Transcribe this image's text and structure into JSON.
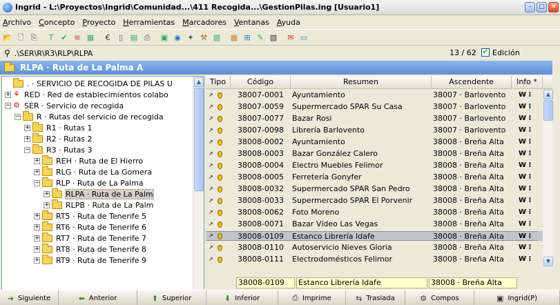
{
  "window": {
    "title": "Ingrid - L:\\Proyectos\\Ingrid\\Comunidad...\\411 Recogida...\\GestionPilas.ing  [Usuario1]"
  },
  "menu": [
    "Archivo",
    "Concepto",
    "Proyecto",
    "Herramientas",
    "Marcadores",
    "Ventanas",
    "Ayuda"
  ],
  "toolbar_icons": [
    "open-folder-icon",
    "new-document-icon",
    "copy-icon",
    "text-icon",
    "validate-icon",
    "rainbow-icon",
    "calculator-icon",
    "euro-icon",
    "page-icon",
    "table-icon",
    "print-icon",
    "save-icon",
    "globe-icon",
    "wizard-icon",
    "tools-icon",
    "database-icon",
    "chart-icon",
    "network-icon",
    "edit-document-icon",
    "folder-save-icon",
    "mail-icon",
    "window-icon"
  ],
  "path": {
    "text": ".\\SER\\R\\R3\\RLP\\RLPA",
    "position": "13 / 62",
    "edit_label": "Edición",
    "edit_checked": true
  },
  "header": {
    "title": "RLPA · Ruta de La Palma A"
  },
  "tree": [
    {
      "label": ". · SERVICIO DE RECOGIDA DE PILAS U",
      "level": 0,
      "expander": "",
      "icon": "folder"
    },
    {
      "label": "RED · Red de establecimientos colabo",
      "level": 0,
      "expander": "+",
      "icon": "network"
    },
    {
      "label": "SER · Servicio de recogida",
      "level": 0,
      "expander": "−",
      "icon": "service"
    },
    {
      "label": "R · Rutas del servicio de recogida",
      "level": 1,
      "expander": "−",
      "icon": "folder"
    },
    {
      "label": "R1 · Rutas 1",
      "level": 2,
      "expander": "+",
      "icon": "folder"
    },
    {
      "label": "R2 · Rutas 2",
      "level": 2,
      "expander": "+",
      "icon": "folder"
    },
    {
      "label": "R3 · Rutas 3",
      "level": 2,
      "expander": "−",
      "icon": "folder"
    },
    {
      "label": "REH · Ruta de El Hierro",
      "level": 3,
      "expander": "+",
      "icon": "folder"
    },
    {
      "label": "RLG · Ruta de La Gomera",
      "level": 3,
      "expander": "+",
      "icon": "folder"
    },
    {
      "label": "RLP · Ruta de La Palma",
      "level": 3,
      "expander": "−",
      "icon": "folder"
    },
    {
      "label": "RLPA · Ruta de La Palm",
      "level": 4,
      "expander": "+",
      "icon": "folder",
      "selected": true
    },
    {
      "label": "RLPB · Ruta de La Palm",
      "level": 4,
      "expander": "+",
      "icon": "folder"
    },
    {
      "label": "RT5 · Ruta de Tenerife 5",
      "level": 3,
      "expander": "+",
      "icon": "folder"
    },
    {
      "label": "RT6 · Ruta de Tenerife 6",
      "level": 3,
      "expander": "+",
      "icon": "folder"
    },
    {
      "label": "RT7 · Ruta de Tenerife 7",
      "level": 3,
      "expander": "+",
      "icon": "folder"
    },
    {
      "label": "RT8 · Ruta de Tenerife 8",
      "level": 3,
      "expander": "+",
      "icon": "folder"
    },
    {
      "label": "RT9 · Ruta de Tenerife 9",
      "level": 3,
      "expander": "+",
      "icon": "folder"
    }
  ],
  "grid": {
    "columns": [
      "Tipo",
      "Código",
      "Resumen",
      "Ascendente",
      "Info *"
    ],
    "rows": [
      {
        "codigo": "38007-0001",
        "resumen": "Ayuntamiento",
        "ascendente": "38007 · Barlovento"
      },
      {
        "codigo": "38007-0059",
        "resumen": "Supermercado SPAR Su Casa",
        "ascendente": "38007 · Barlovento"
      },
      {
        "codigo": "38007-0077",
        "resumen": "Bazar Rosi",
        "ascendente": "38007 · Barlovento"
      },
      {
        "codigo": "38007-0098",
        "resumen": "Librería Barlovento",
        "ascendente": "38007 · Barlovento"
      },
      {
        "codigo": "38008-0002",
        "resumen": "Ayuntamiento",
        "ascendente": "38008 · Breña Alta"
      },
      {
        "codigo": "38008-0003",
        "resumen": "Bazar González Calero",
        "ascendente": "38008 · Breña Alta"
      },
      {
        "codigo": "38008-0004",
        "resumen": "Electro Muebles Felimor",
        "ascendente": "38008 · Breña Alta"
      },
      {
        "codigo": "38008-0005",
        "resumen": "Ferretería Gonyfer",
        "ascendente": "38008 · Breña Alta"
      },
      {
        "codigo": "38008-0032",
        "resumen": "Supermercado SPAR San Pedro",
        "ascendente": "38008 · Breña Alta"
      },
      {
        "codigo": "38008-0033",
        "resumen": "Supermercado SPAR El Porvenir",
        "ascendente": "38008 · Breña Alta"
      },
      {
        "codigo": "38008-0062",
        "resumen": "Foto Moreno",
        "ascendente": "38008 · Breña Alta"
      },
      {
        "codigo": "38008-0071",
        "resumen": "Bazar Vídeo Las Vegas",
        "ascendente": "38008 · Breña Alta"
      },
      {
        "codigo": "38008-0109",
        "resumen": "Estanco Librería Idafe",
        "ascendente": "38008 · Breña Alta",
        "selected": true
      },
      {
        "codigo": "38008-0110",
        "resumen": "Autoservicio Nieves Gloria",
        "ascendente": "38008 · Breña Alta"
      },
      {
        "codigo": "38008-0111",
        "resumen": "Electrodomésticos Felimor",
        "ascendente": "38008 · Breña Alta"
      }
    ],
    "info_glyph": "W ⁝"
  },
  "edit_row": {
    "codigo": "38008-0109",
    "resumen": "Estanco Librería Idafe",
    "ascendente": "38008 · Breña Alta"
  },
  "bottom_buttons": [
    {
      "label": "Siguiente",
      "icon": "arrow-right-icon",
      "glyph": "➜"
    },
    {
      "label": "Anterior",
      "icon": "arrow-left-icon",
      "glyph": "⬅"
    },
    {
      "label": "Superior",
      "icon": "arrow-up-icon",
      "glyph": "⬆"
    },
    {
      "label": "Inferior",
      "icon": "arrow-down-icon",
      "glyph": "⬇"
    },
    {
      "label": "Imprime",
      "icon": "printer-icon",
      "glyph": "⎙"
    },
    {
      "label": "Traslada",
      "icon": "move-icon",
      "glyph": "⇆"
    },
    {
      "label": "Compos",
      "icon": "compose-icon",
      "glyph": "⚙"
    },
    {
      "label": "Ingrid(P)",
      "icon": "ingrid-icon",
      "glyph": "▣"
    }
  ],
  "colors": {
    "header_blue": "#5f8fd3",
    "selection_gray": "#c2c6cc",
    "edit_yellow": "#ffffd0"
  }
}
